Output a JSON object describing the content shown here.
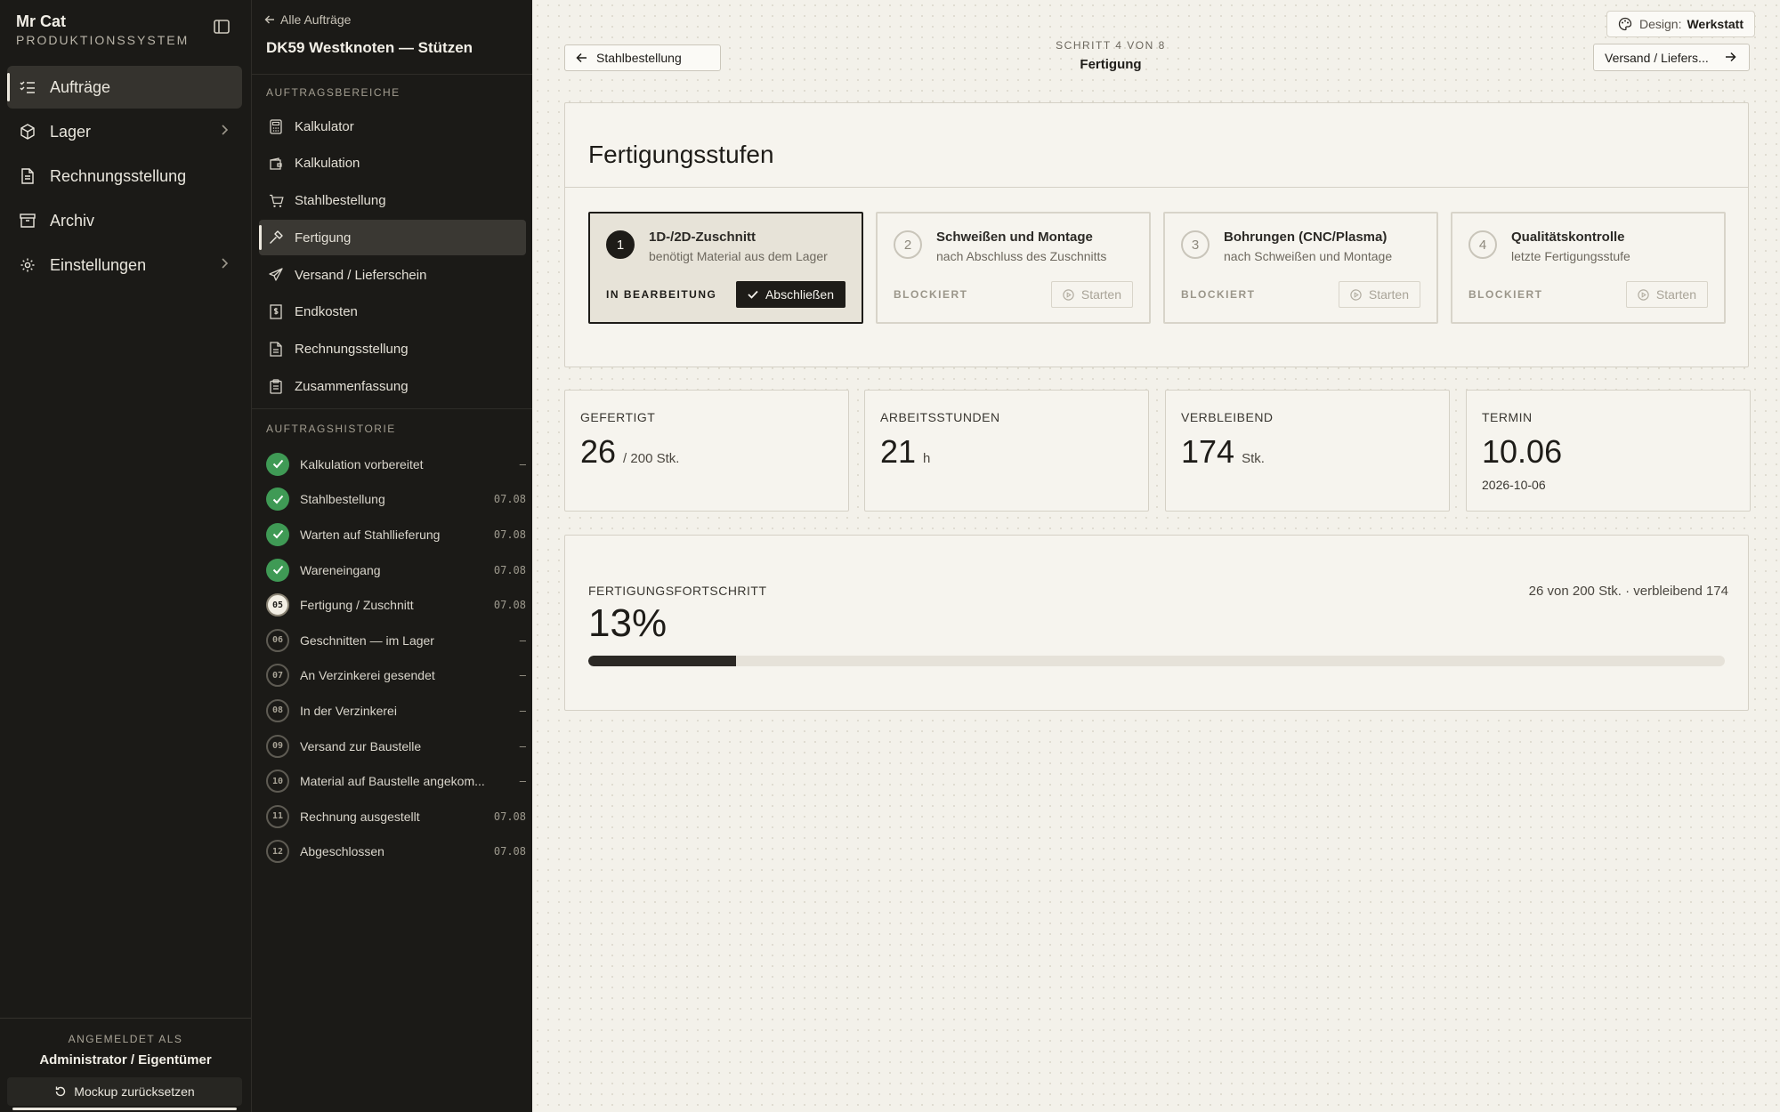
{
  "brand": {
    "name": "Mr Cat",
    "subtitle": "PRODUKTIONSSYSTEM"
  },
  "nav": [
    {
      "label": "Aufträge",
      "icon": "list-check-icon",
      "active": true,
      "chevron": false
    },
    {
      "label": "Lager",
      "icon": "package-icon",
      "active": false,
      "chevron": true
    },
    {
      "label": "Rechnungsstellung",
      "icon": "document-icon",
      "active": false,
      "chevron": false
    },
    {
      "label": "Archiv",
      "icon": "archive-icon",
      "active": false,
      "chevron": false
    },
    {
      "label": "Einstellungen",
      "icon": "gear-icon",
      "active": false,
      "chevron": true
    }
  ],
  "login": {
    "label": "ANGEMELDET ALS",
    "user": "Administrator / Eigentümer",
    "reset_label": "Mockup zurücksetzen"
  },
  "order": {
    "back_label": "Alle Aufträge",
    "title": "DK59 Westknoten — Stützen",
    "areas_label": "AUFTRAGSBEREICHE",
    "areas": [
      {
        "label": "Kalkulator",
        "icon": "calculator-icon",
        "active": false
      },
      {
        "label": "Kalkulation",
        "icon": "wallet-icon",
        "active": false
      },
      {
        "label": "Stahlbestellung",
        "icon": "cart-icon",
        "active": false
      },
      {
        "label": "Fertigung",
        "icon": "hammer-icon",
        "active": true
      },
      {
        "label": "Versand / Lieferschein",
        "icon": "send-icon",
        "active": false
      },
      {
        "label": "Endkosten",
        "icon": "receipt-icon",
        "active": false
      },
      {
        "label": "Rechnungsstellung",
        "icon": "document-icon",
        "active": false
      },
      {
        "label": "Zusammenfassung",
        "icon": "clipboard-icon",
        "active": false
      }
    ],
    "history_label": "AUFTRAGSHISTORIE",
    "history": [
      {
        "badge": "",
        "state": "done",
        "label": "Kalkulation vorbereitet",
        "date": "—"
      },
      {
        "badge": "",
        "state": "done",
        "label": "Stahlbestellung",
        "date": "07.08"
      },
      {
        "badge": "",
        "state": "done",
        "label": "Warten auf Stahllieferung",
        "date": "07.08"
      },
      {
        "badge": "",
        "state": "done",
        "label": "Wareneingang",
        "date": "07.08"
      },
      {
        "badge": "05",
        "state": "current",
        "label": "Fertigung / Zuschnitt",
        "date": "07.08"
      },
      {
        "badge": "06",
        "state": "todo",
        "label": "Geschnitten — im Lager",
        "date": "—"
      },
      {
        "badge": "07",
        "state": "todo",
        "label": "An Verzinkerei gesendet",
        "date": "—"
      },
      {
        "badge": "08",
        "state": "todo",
        "label": "In der Verzinkerei",
        "date": "—"
      },
      {
        "badge": "09",
        "state": "todo",
        "label": "Versand zur Baustelle",
        "date": "—"
      },
      {
        "badge": "10",
        "state": "todo",
        "label": "Material auf Baustelle angekom...",
        "date": "—"
      },
      {
        "badge": "11",
        "state": "todo",
        "label": "Rechnung ausgestellt",
        "date": "07.08"
      },
      {
        "badge": "12",
        "state": "todo",
        "label": "Abgeschlossen",
        "date": "07.08"
      }
    ]
  },
  "design": {
    "key": "Design:",
    "value": "Werkstatt"
  },
  "step": {
    "prev_label": "Stahlbestellung",
    "next_label": "Versand / Liefers...",
    "count": "SCHRITT 4 VON 8",
    "name": "Fertigung"
  },
  "stufen": {
    "title": "Fertigungsstufen",
    "stages": [
      {
        "num": "1",
        "title": "1D-/2D-Zuschnitt",
        "sub": "benötigt Material aus dem Lager",
        "status": "IN BEARBEITUNG",
        "action": "Abschließen",
        "active": true
      },
      {
        "num": "2",
        "title": "Schweißen und Montage",
        "sub": "nach Abschluss des Zuschnitts",
        "status": "BLOCKIERT",
        "action": "Starten",
        "active": false
      },
      {
        "num": "3",
        "title": "Bohrungen (CNC/Plasma)",
        "sub": "nach Schweißen und Montage",
        "status": "BLOCKIERT",
        "action": "Starten",
        "active": false
      },
      {
        "num": "4",
        "title": "Qualitätskontrolle",
        "sub": "letzte Fertigungsstufe",
        "status": "BLOCKIERT",
        "action": "Starten",
        "active": false
      }
    ]
  },
  "stats": [
    {
      "label": "GEFERTIGT",
      "value": "26",
      "unit": "/ 200 Stk.",
      "extra": ""
    },
    {
      "label": "ARBEITSSTUNDEN",
      "value": "21",
      "unit": "h",
      "extra": ""
    },
    {
      "label": "VERBLEIBEND",
      "value": "174",
      "unit": "Stk.",
      "extra": ""
    },
    {
      "label": "TERMIN",
      "value": "10.06",
      "unit": "",
      "extra": "2026-10-06"
    }
  ],
  "progress": {
    "label": "FERTIGUNGSFORTSCHRITT",
    "value": "13%",
    "fraction": 0.13,
    "detail": "26 von 200 Stk. · verbleibend 174"
  },
  "colors": {
    "done": "#3f9a55",
    "dark": "#1e1c18",
    "sidebar": "#1b1a17",
    "background": "#f3f1ea"
  }
}
